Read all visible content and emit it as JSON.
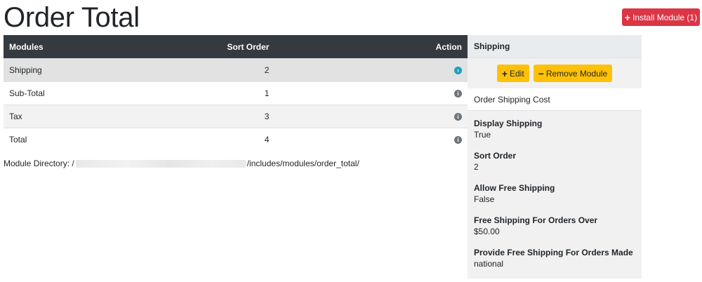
{
  "page": {
    "title": "Order Total",
    "install_button": "Install Module (1)"
  },
  "table": {
    "headers": {
      "modules": "Modules",
      "sort_order": "Sort Order",
      "action": "Action"
    },
    "rows": [
      {
        "name": "Shipping",
        "sort": "2",
        "action_icon": "chevron-right-circle-icon"
      },
      {
        "name": "Sub-Total",
        "sort": "1",
        "action_icon": "info-circle-icon"
      },
      {
        "name": "Tax",
        "sort": "3",
        "action_icon": "info-circle-icon"
      },
      {
        "name": "Total",
        "sort": "4",
        "action_icon": "info-circle-icon"
      }
    ]
  },
  "module_directory": {
    "label": "Module Directory: /",
    "path_suffix": "/includes/modules/order_total/"
  },
  "side_panel": {
    "title": "Shipping",
    "edit_button": "Edit",
    "remove_button": "Remove Module",
    "description": "Order Shipping Cost",
    "settings": [
      {
        "key": "Display Shipping",
        "value": "True"
      },
      {
        "key": "Sort Order",
        "value": "2"
      },
      {
        "key": "Allow Free Shipping",
        "value": "False"
      },
      {
        "key": "Free Shipping For Orders Over",
        "value": "$50.00"
      },
      {
        "key": "Provide Free Shipping For Orders Made",
        "value": "national"
      }
    ]
  },
  "colors": {
    "danger": "#dc3545",
    "warning": "#ffc107",
    "table_header": "#343a40",
    "info_icon": "#6c757d",
    "selected_icon": "#17a2b8"
  }
}
